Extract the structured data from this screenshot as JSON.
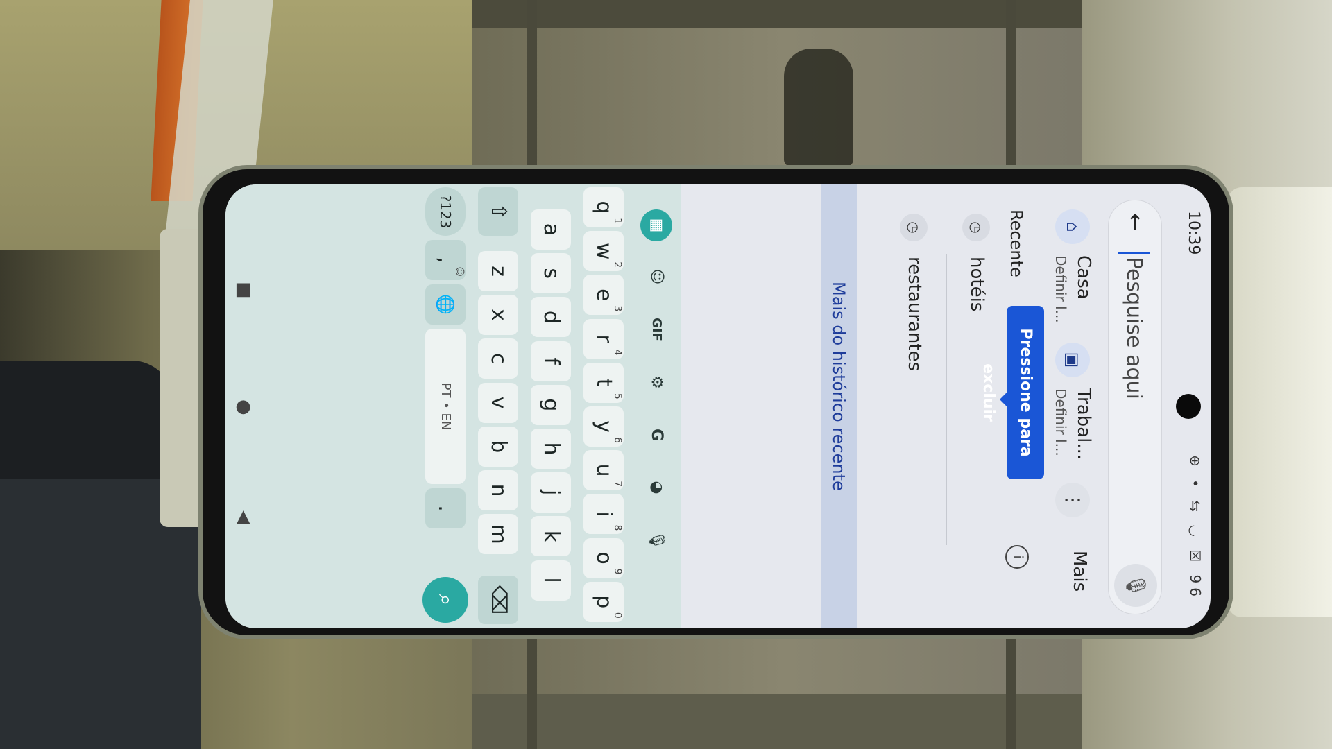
{
  "status": {
    "time": "10:39",
    "icons": "⊕ • ⇆ ◡ ☒ 96"
  },
  "search": {
    "placeholder": "Pesquise aqui",
    "back": "←",
    "mic": "🎙"
  },
  "places": [
    {
      "icon": "⌂",
      "name": "Casa",
      "sub": "Definir l..."
    },
    {
      "icon": "▣",
      "name": "Trabal...",
      "sub": "Definir l..."
    }
  ],
  "more_dots": "⋮",
  "more_label": "Mais",
  "recent": {
    "heading": "Recente",
    "info": "i",
    "tooltip": "Pressione para excluir",
    "items": [
      {
        "icon": "◷",
        "label": "hotéis"
      },
      {
        "icon": "◷",
        "label": "restaurantes"
      }
    ],
    "more_history": "Mais do histórico recente"
  },
  "keyboard": {
    "tools": [
      "▦",
      "☺",
      "GIF",
      "⚙",
      "G",
      "◕",
      "🎙"
    ],
    "row1": [
      {
        "k": "q",
        "s": "1"
      },
      {
        "k": "w",
        "s": "2"
      },
      {
        "k": "e",
        "s": "3"
      },
      {
        "k": "r",
        "s": "4"
      },
      {
        "k": "t",
        "s": "5"
      },
      {
        "k": "y",
        "s": "6"
      },
      {
        "k": "u",
        "s": "7"
      },
      {
        "k": "i",
        "s": "8"
      },
      {
        "k": "o",
        "s": "9"
      },
      {
        "k": "p",
        "s": "0"
      }
    ],
    "row2": [
      "a",
      "s",
      "d",
      "f",
      "g",
      "h",
      "j",
      "k",
      "l"
    ],
    "row3": [
      "z",
      "x",
      "c",
      "v",
      "b",
      "n",
      "m"
    ],
    "shift": "⇧",
    "backspace": "⌫",
    "sym": "?123",
    "comma": ",",
    "emoji": "☺",
    "globe": "🌐",
    "space": "PT • EN",
    "period": ".",
    "go": "⌕"
  },
  "nav": {
    "recents": "■",
    "home": "●",
    "back": "◀"
  }
}
